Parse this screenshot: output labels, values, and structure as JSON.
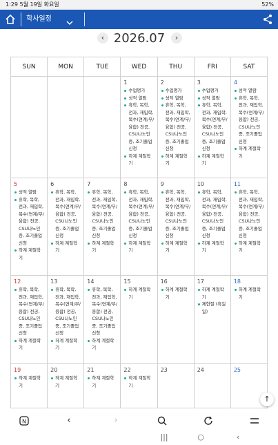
{
  "status_bar": {
    "left_text": "1:29  5월 19일 화요일",
    "right_text": "52%"
  },
  "app_bar": {
    "title": "학사일정"
  },
  "calendar": {
    "month_label": "2026.07",
    "weekdays": [
      "SUN",
      "MON",
      "TUE",
      "WED",
      "THU",
      "FRI",
      "SAT"
    ],
    "weeks": [
      [
        {
          "day": "",
          "events": []
        },
        {
          "day": "",
          "events": []
        },
        {
          "day": "",
          "events": []
        },
        {
          "day": "1",
          "events": [
            "수업평가",
            "성적 열람",
            "휴학, 복학, 전과, 재입학, 복수(연계/부/융합) 전공, CSU나노인증, 조기졸업 신청",
            "하계 계절학기"
          ]
        },
        {
          "day": "2",
          "events": [
            "수업평가",
            "성적 열람",
            "휴학, 복학, 전과, 재입학, 복수(연계/부/융합) 전공, CSU나노인증, 조기졸업 신청",
            "하계 계절학기"
          ]
        },
        {
          "day": "3",
          "events": [
            "수업평가",
            "성적 열람",
            "휴학, 복학, 전과, 재입학, 복수(연계/부/융합) 전공, CSU나노인증, 조기졸업 신청",
            "하계 계절학기"
          ]
        },
        {
          "day": "4",
          "events": [
            "성적 열람",
            "휴학, 복학, 전과, 재입학, 복수(연계/부/융합) 전공, CSU나노인증, 조기졸업 신청",
            "하계 계절학기"
          ]
        }
      ],
      [
        {
          "day": "5",
          "events": [
            "성적 열람",
            "휴학, 복학, 전과, 재입학, 복수(연계/부/융합) 전공, CSU나노인증, 조기졸업 신청",
            "하계 계절학기"
          ]
        },
        {
          "day": "6",
          "events": [
            "휴학, 복학, 전과, 재입학, 복수(연계/부/융합) 전공, CSU나노인증, 조기졸업 신청",
            "하계 계절학기"
          ]
        },
        {
          "day": "7",
          "events": [
            "휴학, 복학, 전과, 재입학, 복수(연계/부/융합) 전공, CSU나노인증, 조기졸업 신청",
            "하계 계절학기"
          ]
        },
        {
          "day": "8",
          "events": [
            "휴학, 복학, 전과, 재입학, 복수(연계/부/융합) 전공, CSU나노인증, 조기졸업 신청",
            "하계 계절학기"
          ]
        },
        {
          "day": "9",
          "events": [
            "휴학, 복학, 전과, 재입학, 복수(연계/부/융합) 전공, CSU나노인증, 조기졸업 신청",
            "하계 계절학기"
          ]
        },
        {
          "day": "10",
          "events": [
            "휴학, 복학, 전과, 재입학, 복수(연계/부/융합) 전공, CSU나노인증, 조기졸업 신청",
            "하계 계절학기"
          ]
        },
        {
          "day": "11",
          "events": [
            "휴학, 복학, 전과, 재입학, 복수(연계/부/융합) 전공, CSU나노인증, 조기졸업 신청",
            "하계 계절학기"
          ]
        }
      ],
      [
        {
          "day": "12",
          "events": [
            "휴학, 복학, 전과, 재입학, 복수(연계/부/융합) 전공, CSU나노인증, 조기졸업 신청",
            "하계 계절학기"
          ]
        },
        {
          "day": "13",
          "events": [
            "휴학, 복학, 전과, 재입학, 복수(연계/부/융합) 전공, CSU나노인증, 조기졸업 신청",
            "하계 계절학기"
          ]
        },
        {
          "day": "14",
          "events": [
            "휴학, 복학, 전과, 재입학, 복수(연계/부/융합) 전공, CSU나노인증, 조기졸업 신청",
            "하계 계절학기"
          ]
        },
        {
          "day": "15",
          "events": [
            "하계 계절학기"
          ]
        },
        {
          "day": "16",
          "events": [
            "하계 계절학기"
          ]
        },
        {
          "day": "17",
          "events": [
            "하계 계절학기",
            "제헌절 (휴일일)"
          ]
        },
        {
          "day": "18",
          "events": [
            "하계 계절학기"
          ]
        }
      ],
      [
        {
          "day": "19",
          "events": [
            "하계 계절학기"
          ]
        },
        {
          "day": "20",
          "events": [
            "하계 계절학기"
          ]
        },
        {
          "day": "21",
          "events": [
            "하계 계절학기"
          ]
        },
        {
          "day": "22",
          "events": [
            "하계 계절학기"
          ]
        },
        {
          "day": "23",
          "events": []
        },
        {
          "day": "24",
          "events": []
        },
        {
          "day": "25",
          "events": []
        }
      ]
    ]
  },
  "colors": {
    "app_bar": "#1b57b4",
    "sunday": "#d23030",
    "saturday": "#2a6fc4",
    "event_bullet": "#1aa89a"
  }
}
